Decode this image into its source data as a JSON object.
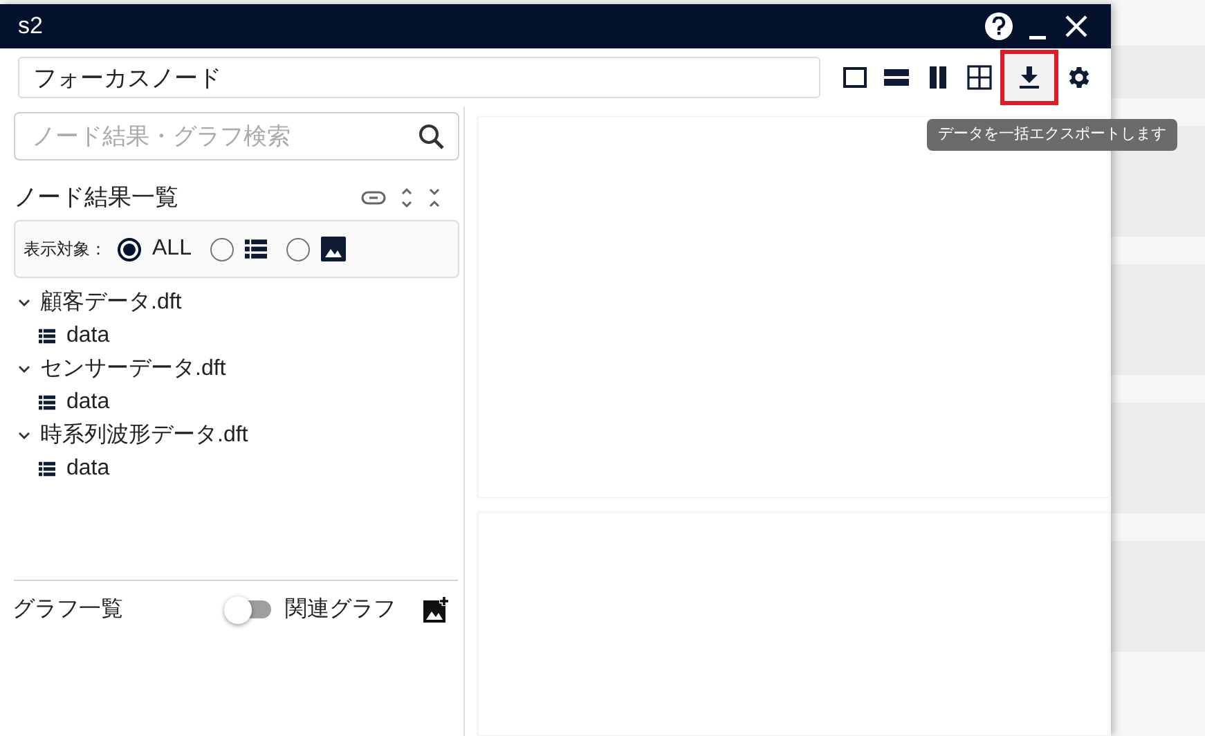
{
  "window": {
    "title": "s2"
  },
  "focus_field": {
    "value": "フォーカスノード"
  },
  "toolbar": [
    {
      "kind": "single",
      "highlighted": false
    },
    {
      "kind": "rows",
      "highlighted": false
    },
    {
      "kind": "columns",
      "highlighted": false
    },
    {
      "kind": "grid",
      "highlighted": false
    },
    {
      "kind": "download",
      "highlighted": true
    },
    {
      "kind": "settings",
      "highlighted": false
    }
  ],
  "tooltip": "データを一括エクスポートします",
  "search": {
    "placeholder": "ノード結果・グラフ検索"
  },
  "node_results": {
    "title": "ノード結果一覧",
    "filter_label": "表示対象：",
    "filter_options": [
      {
        "kind": "text",
        "label": "ALL",
        "selected": true
      },
      {
        "kind": "table",
        "selected": false
      },
      {
        "kind": "image",
        "selected": false
      }
    ]
  },
  "tree": [
    {
      "label": "顧客データ.dft",
      "expanded": true,
      "children": [
        {
          "label": "data"
        }
      ]
    },
    {
      "label": "センサーデータ.dft",
      "expanded": true,
      "children": [
        {
          "label": "data"
        }
      ]
    },
    {
      "label": "時系列波形データ.dft",
      "expanded": true,
      "children": [
        {
          "label": "data"
        }
      ]
    }
  ],
  "graph_list": {
    "title": "グラフ一覧",
    "toggle": {
      "label": "関連グラフ",
      "on": false
    }
  }
}
